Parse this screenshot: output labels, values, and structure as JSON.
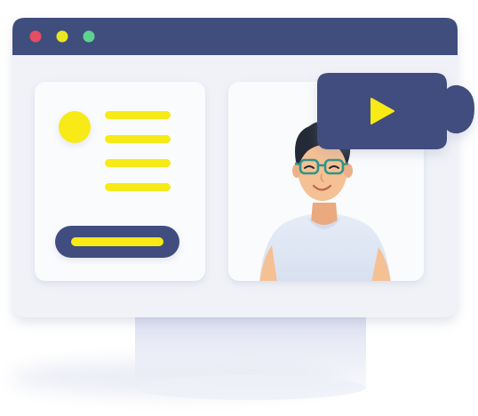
{
  "illustration": {
    "window_controls": [
      "close-dot",
      "minimize-dot",
      "maximize-dot"
    ],
    "icons": {
      "play": "play-icon",
      "avatar": "person-avatar"
    },
    "colors": {
      "navy": "#404e7e",
      "yellow": "#f7ea15",
      "red_dot": "#e34f63",
      "yellow_dot": "#e9e71f",
      "green_dot": "#5ed28f",
      "window_bg": "#f0f2f7",
      "panel_bg": "#fafbfd",
      "shirt": "#e3e9f6",
      "skin": "#f5c094",
      "hair": "#232a36",
      "glasses": "#2f9589",
      "stand": "#e8ebf6"
    }
  }
}
